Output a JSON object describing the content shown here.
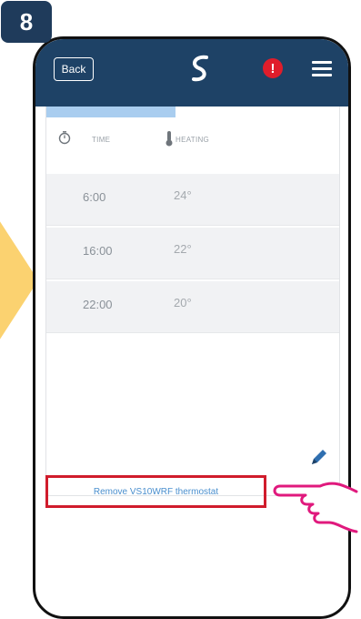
{
  "step": {
    "number": "8"
  },
  "colors": {
    "header": "#1e4266",
    "badge": "#1f3b5b",
    "alert": "#e01d2b",
    "arrow": "#fbd270",
    "highlight": "#d01c2c",
    "link": "#4a8fce",
    "hand": "#e0197d",
    "progress": "#a9cdef"
  },
  "header": {
    "back_label": "Back",
    "logo_icon": "salus-logo",
    "alert_symbol": "!",
    "menu_icon": "hamburger-menu"
  },
  "schedule": {
    "time_header": "TIME",
    "heating_header": "HEATING",
    "rows": [
      {
        "time": "6:00",
        "temp": "24°"
      },
      {
        "time": "16:00",
        "temp": "22°"
      },
      {
        "time": "22:00",
        "temp": "20°"
      }
    ]
  },
  "actions": {
    "remove_label": "Remove VS10WRF thermostat"
  }
}
